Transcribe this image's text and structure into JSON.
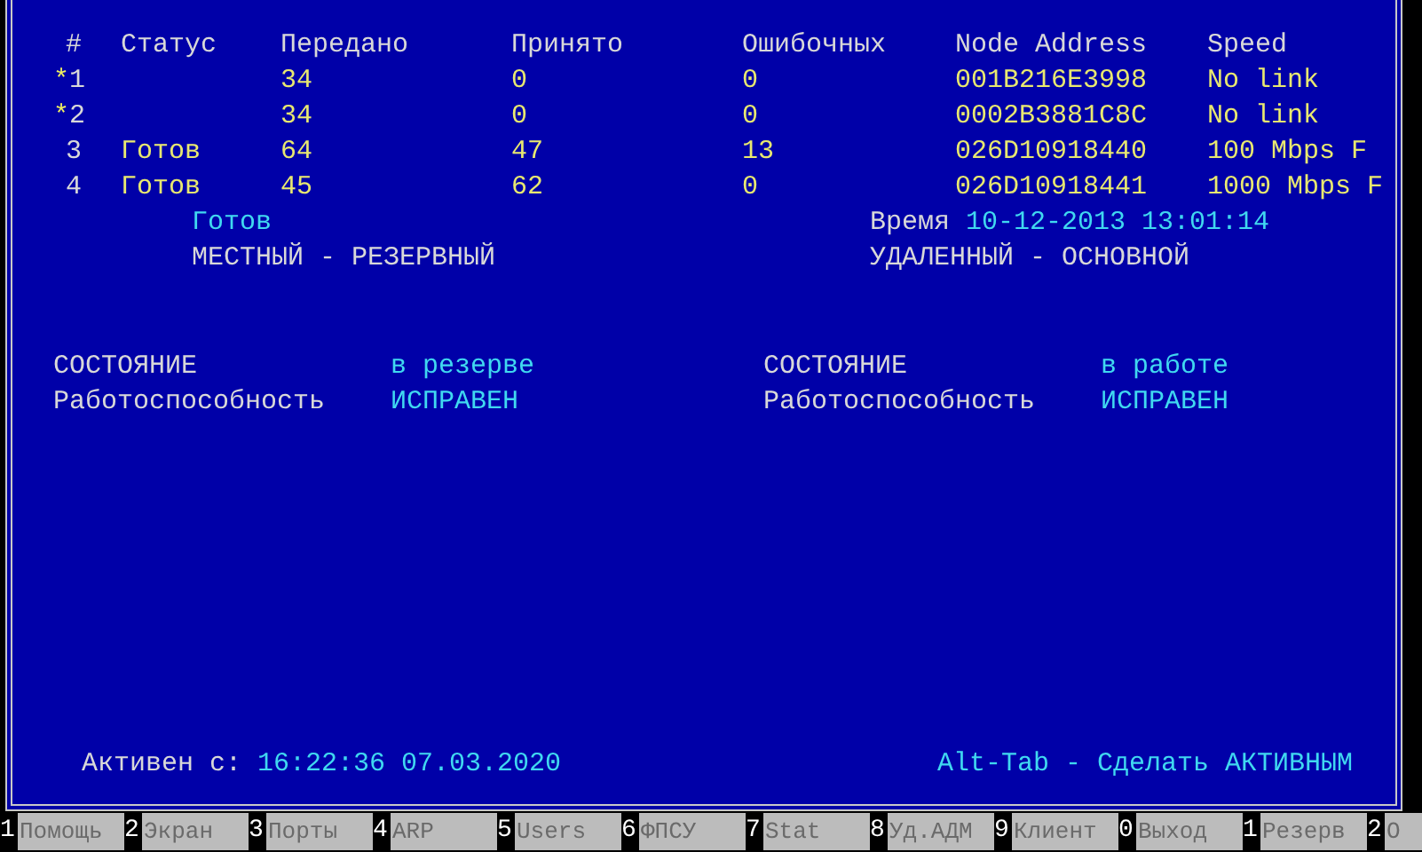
{
  "table": {
    "columns": [
      "#",
      "Статус",
      "Передано",
      "Принято",
      "Ошибочных",
      "Node Address",
      "Speed"
    ],
    "rows": [
      {
        "marker": "*",
        "number": "1",
        "sent": "34",
        "received": "0",
        "errors": "0",
        "node_address": "001B216E3998",
        "speed": "No link"
      },
      {
        "marker": "*",
        "number": "2",
        "sent": "34",
        "received": "0",
        "errors": "0",
        "node_address": "0002B3881C8C",
        "speed": "No link"
      },
      {
        "number": "3",
        "status": "Готов",
        "sent": "64",
        "received": "47",
        "errors": "13",
        "node_address": "026D10918440",
        "speed": "100 Mbps F"
      },
      {
        "number": "4",
        "status": "Готов",
        "sent": "45",
        "received": "62",
        "errors": "0",
        "node_address": "026D10918441",
        "speed": "1000 Mbps F"
      }
    ]
  },
  "local": {
    "status": "Готов",
    "role": "МЕСТНЫЙ - РЕЗЕРВНЫЙ"
  },
  "remote": {
    "time_label": "Время",
    "time": "10-12-2013 13:01:14",
    "role": "УДАЛЕННЫЙ - ОСНОВНОЙ"
  },
  "states": [
    {
      "state_label": "СОСТОЯНИЕ",
      "state": "в резерве",
      "health_label": "Работоспособность",
      "health": "ИСПРАВЕН"
    },
    {
      "state_label": "СОСТОЯНИЕ",
      "state": "в работе",
      "health_label": "Работоспособность",
      "health": "ИСПРАВЕН"
    }
  ],
  "footer": {
    "active_label": "Активен с:",
    "active_since": "16:22:36 07.03.2020",
    "hint": "Alt-Tab - Сделать АКТИВНЫМ"
  },
  "function_keys": [
    {
      "key": "1",
      "label": "Помощь"
    },
    {
      "key": "2",
      "label": "Экран"
    },
    {
      "key": "3",
      "label": "Порты"
    },
    {
      "key": "4",
      "label": "ARP"
    },
    {
      "key": "5",
      "label": "Users"
    },
    {
      "key": "6",
      "label": "ФПСУ"
    },
    {
      "key": "7",
      "label": "Stat"
    },
    {
      "key": "8",
      "label": "Уд.АДМ"
    },
    {
      "key": "9",
      "label": "Клиент"
    },
    {
      "key": "0",
      "label": "Выход"
    },
    {
      "key": "1",
      "label": "Резерв"
    },
    {
      "key": "2",
      "label": "О"
    }
  ]
}
